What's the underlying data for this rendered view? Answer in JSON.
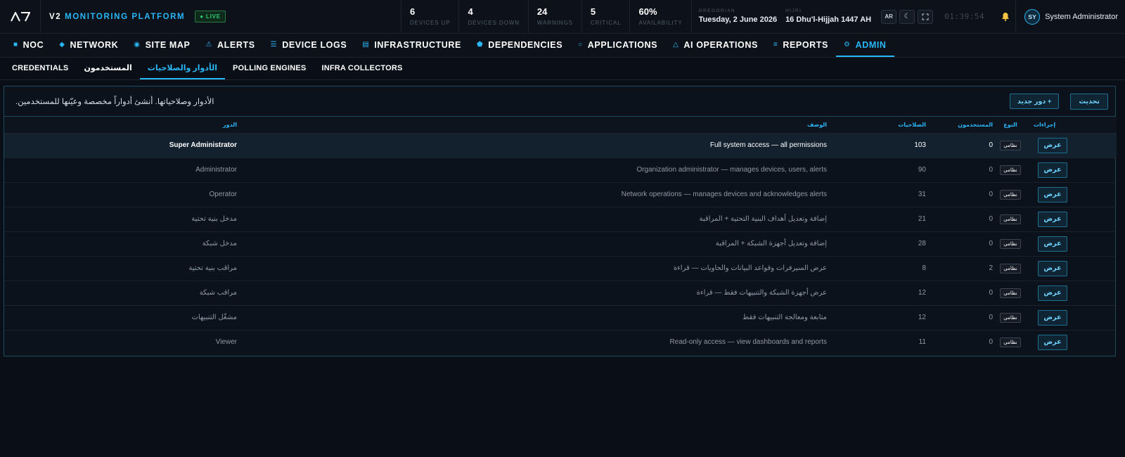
{
  "header": {
    "title_prefix": "V2",
    "title": "MONITORING PLATFORM",
    "live_badge": "● LIVE",
    "stats": [
      {
        "value": "6",
        "label": "DEVICES UP"
      },
      {
        "value": "4",
        "label": "DEVICES DOWN"
      },
      {
        "value": "24",
        "label": "WARNINGS"
      },
      {
        "value": "5",
        "label": "CRITICAL"
      },
      {
        "value": "60%",
        "label": "AVAILABILITY"
      }
    ],
    "gregorian_label": "GREGORIAN",
    "gregorian_date": "Tuesday, 2 June 2026",
    "hijri_label": "HIJRI",
    "hijri_date": "16 Dhu'l-Hijjah 1447 AH",
    "lang_button": "AR",
    "clock": "01:39:54",
    "user_initials": "SY",
    "user_name": "System Administrator"
  },
  "nav": {
    "items": [
      {
        "label": "NOC",
        "icon": "square-icon"
      },
      {
        "label": "NETWORK",
        "icon": "diamond-icon"
      },
      {
        "label": "SITE MAP",
        "icon": "target-icon"
      },
      {
        "label": "ALERTS",
        "icon": "warning-icon"
      },
      {
        "label": "DEVICE LOGS",
        "icon": "list-icon"
      },
      {
        "label": "INFRASTRUCTURE",
        "icon": "server-icon"
      },
      {
        "label": "DEPENDENCIES",
        "icon": "pentagon-icon"
      },
      {
        "label": "APPLICATIONS",
        "icon": "circle-icon"
      },
      {
        "label": "AI OPERATIONS",
        "icon": "triangle-icon"
      },
      {
        "label": "REPORTS",
        "icon": "report-icon"
      },
      {
        "label": "ADMIN",
        "icon": "gear-icon"
      }
    ],
    "active_index": 10
  },
  "subnav": {
    "items": [
      "CREDENTIALS",
      "المستخدمون",
      "الأدوار والصلاحيات",
      "POLLING ENGINES",
      "INFRA COLLECTORS"
    ],
    "active_index": 2
  },
  "panel": {
    "description": ".الأدوار وصلاحياتها. أنشئ أدواراً مخصصة وعيّنها للمستخدمين",
    "refresh_button": "تحديث",
    "new_role_button": "دور جديد +"
  },
  "table": {
    "headers": {
      "role": "الدور",
      "description": "الوصف",
      "permissions": "الصلاحيات",
      "users": "المستخدمون",
      "type": "النوع",
      "actions": "إجراءات"
    },
    "rows": [
      {
        "role": "Super Administrator",
        "description": "Full system access — all permissions",
        "permissions": "103",
        "users": "0",
        "type": "نظامي",
        "action": "عرض"
      },
      {
        "role": "Administrator",
        "description": "Organization administrator — manages devices, users, alerts",
        "permissions": "90",
        "users": "0",
        "type": "نظامي",
        "action": "عرض"
      },
      {
        "role": "Operator",
        "description": "Network operations — manages devices and acknowledges alerts",
        "permissions": "31",
        "users": "0",
        "type": "نظامي",
        "action": "عرض"
      },
      {
        "role": "مدخل بنية تحتية",
        "description": "إضافة وتعديل أهداف البنية التحتية + المراقبة",
        "permissions": "21",
        "users": "0",
        "type": "نظامي",
        "action": "عرض"
      },
      {
        "role": "مدخل شبكة",
        "description": "إضافة وتعديل أجهزة الشبكة + المراقبة",
        "permissions": "28",
        "users": "0",
        "type": "نظامي",
        "action": "عرض"
      },
      {
        "role": "مراقب بنية تحتية",
        "description": "عرض السيرفرات وقواعد البيانات والحاويات — قراءة",
        "permissions": "8",
        "users": "2",
        "type": "نظامي",
        "action": "عرض"
      },
      {
        "role": "مراقب شبكة",
        "description": "عرض أجهزة الشبكة والتنبيهات فقط — قراءة",
        "permissions": "12",
        "users": "0",
        "type": "نظامي",
        "action": "عرض"
      },
      {
        "role": "مشغّل التنبيهات",
        "description": "متابعة ومعالجة التنبيهات فقط",
        "permissions": "12",
        "users": "0",
        "type": "نظامي",
        "action": "عرض"
      },
      {
        "role": "Viewer",
        "description": "Read-only access — view dashboards and reports",
        "permissions": "11",
        "users": "0",
        "type": "نظامي",
        "action": "عرض"
      }
    ]
  },
  "colors": {
    "accent": "#29b6f6",
    "live": "#2ecc71",
    "background": "#0a0f17",
    "panel_border": "#1e4a5c"
  }
}
